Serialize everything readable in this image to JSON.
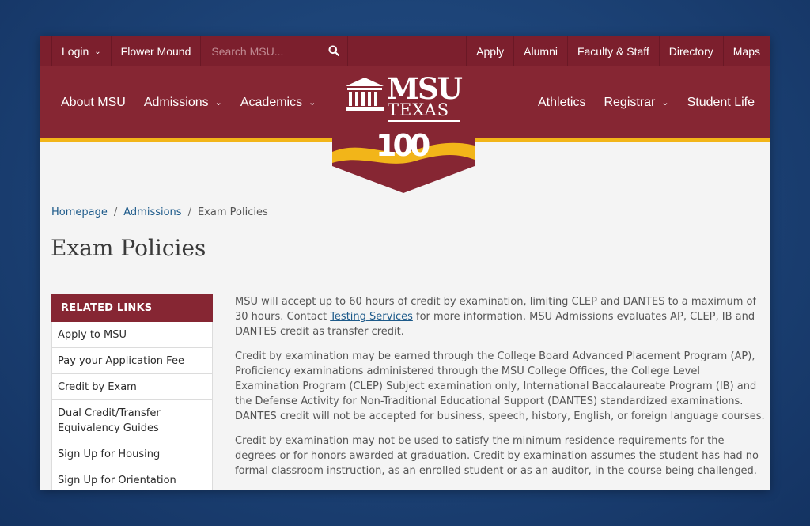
{
  "utility_bar": {
    "login_label": "Login",
    "campus_label": "Flower Mound",
    "search_placeholder": "Search MSU...",
    "links": [
      "Apply",
      "Alumni",
      "Faculty & Staff",
      "Directory",
      "Maps"
    ]
  },
  "main_nav": {
    "left": [
      {
        "label": "About MSU",
        "dropdown": false
      },
      {
        "label": "Admissions",
        "dropdown": true
      },
      {
        "label": "Academics",
        "dropdown": true
      }
    ],
    "right": [
      {
        "label": "Athletics",
        "dropdown": false
      },
      {
        "label": "Registrar",
        "dropdown": true
      },
      {
        "label": "Student Life",
        "dropdown": false
      }
    ]
  },
  "logo": {
    "line1": "MSU",
    "line2": "TEXAS",
    "anniversary": "100"
  },
  "breadcrumb": {
    "home": "Homepage",
    "section": "Admissions",
    "current": "Exam Policies"
  },
  "page_title": "Exam Policies",
  "sidebar": {
    "heading": "RELATED LINKS",
    "items": [
      "Apply to MSU",
      "Pay your Application Fee",
      "Credit by Exam",
      "Dual Credit/Transfer Equivalency Guides",
      "Sign Up for Housing",
      "Sign Up for Orientation"
    ]
  },
  "content": {
    "p1_before": "MSU will accept up to 60 hours of credit by examination, limiting CLEP and DANTES to a maximum of 30 hours. Contact ",
    "p1_link": "Testing Services",
    "p1_after": " for more information. MSU Admissions evaluates AP, CLEP, IB and DANTES credit as transfer credit.",
    "p2": "Credit by examination may be earned through the College Board Advanced Placement Program (AP), Proficiency examinations administered through the MSU College Offices, the College Level Examination Program (CLEP) Subject examination only, International Baccalaureate Program (IB) and the Defense Activity for Non-Traditional Educational Support (DANTES) standardized examinations. DANTES credit will not be accepted for business, speech, history, English, or foreign language courses.",
    "p3": "Credit by examination may not be used to satisfy the minimum residence requirements for the degrees or for honors awarded at graduation. Credit by examination assumes the student has had no formal classroom instruction, as an enrolled student or as an auditor, in the course being challenged."
  },
  "colors": {
    "maroon_dark": "#7c1f2d",
    "maroon": "#862633",
    "gold": "#f2b519",
    "link_blue": "#1d5a8a"
  }
}
